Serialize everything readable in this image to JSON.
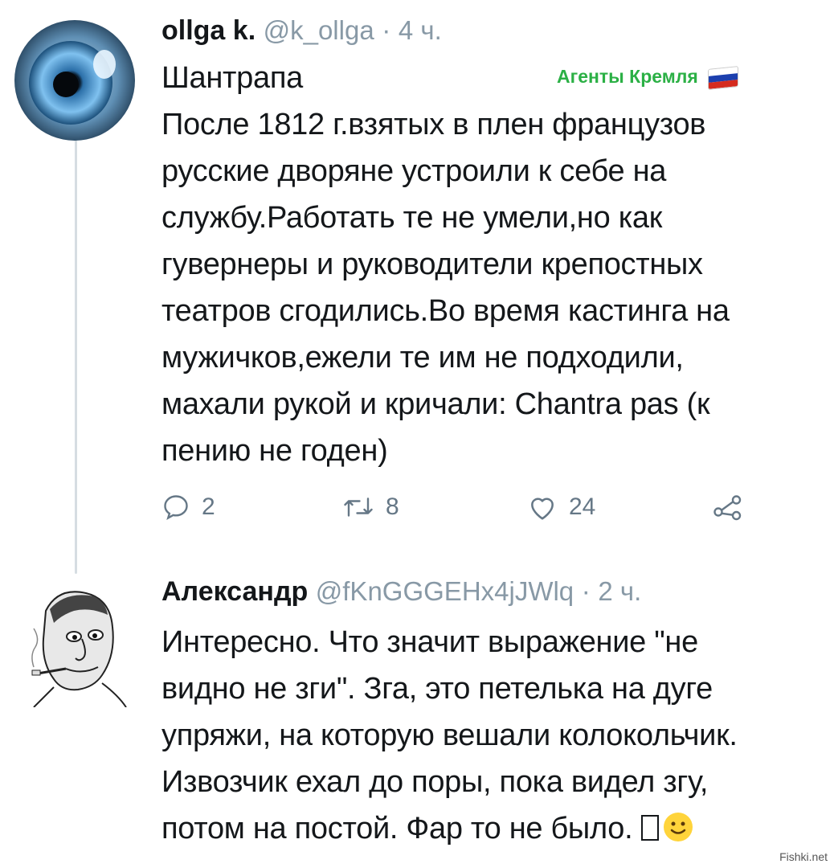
{
  "tweet1": {
    "author_name": "ollga k.",
    "handle": "@k_ollga",
    "separator": "·",
    "time": "4 ч.",
    "text": "Шантрапа\nПосле 1812 г.взятых в плен французов\nрусские дворяне устроили к себе на\nслужбу.Работать те не умели,но как\nгувернеры и руководители крепостных\nтеатров сгодились.Во время кастинга на\nмужичков,ежели те им не подходили,\nмахали рукой и кричали: Chantra pas (к\nпению не годен)",
    "overlay_tag": "Агенты Кремля",
    "actions": {
      "reply_count": "2",
      "retweet_count": "8",
      "like_count": "24"
    }
  },
  "tweet2": {
    "author_name": "Александр",
    "handle": "@fKnGGGEHx4jJWlq",
    "separator": "·",
    "time": "2 ч.",
    "text": "Интересно. Что значит выражение \"не\nвидно не зги\". Зга, это петелька на дуге\nупряжи, на которую вешали колокольчик.\nИзвозчик ехал до поры, пока видел згу,\nпотом на постой. Фар то не было. "
  },
  "watermark": "Fishki.net",
  "colors": {
    "text": "#14171a",
    "meta": "#8899a6",
    "action": "#657786",
    "tag_green": "#2bb045",
    "thread_line": "#d6dde2"
  },
  "icons": [
    "reply-icon",
    "retweet-icon",
    "like-icon",
    "share-icon",
    "smiley-emoji-icon",
    "russian-flag-icon"
  ]
}
